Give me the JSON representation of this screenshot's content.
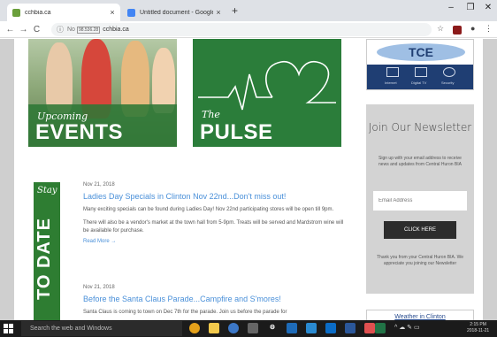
{
  "browser": {
    "tabs": [
      {
        "title": "cchbia.ca",
        "close": "×",
        "favicon_color": "#6a9f3b"
      },
      {
        "title": "Untitled document - Google Docs",
        "close": "×",
        "favicon_color": "#4285f4"
      }
    ],
    "new_tab": "+",
    "window_controls": [
      "–",
      "❐",
      "✕"
    ],
    "nav": {
      "back": "←",
      "forward": "→",
      "reload": "C"
    },
    "address": {
      "info_icon": "ⓘ",
      "security_hint": "No",
      "chip": "98.536.28",
      "url": "cchbia.ca"
    },
    "toolbar_right": {
      "star": "☆",
      "account": "●",
      "menu": "⋮"
    }
  },
  "page": {
    "tiles": [
      {
        "script": "Upcoming",
        "big": "EVENTS"
      },
      {
        "script": "The",
        "big": "PULSE"
      }
    ],
    "tce": {
      "logo_text": "TCE",
      "services": [
        "Internet",
        "Digital TV",
        "Security"
      ]
    },
    "newsletter": {
      "title": "Join Our Newsletter",
      "description": "Sign up with your email address to receive news and updates from Central Huron BIA",
      "email_placeholder": "Email Address",
      "button": "CLICK HERE",
      "thanks": "Thank you from your Central Huron BIA. We appreciate you joining our Newsletter"
    },
    "weather_link": "Weather in Clinton",
    "stay_banner": {
      "script": "Stay",
      "big": "TO DATE"
    },
    "posts": [
      {
        "date": "Nov 21, 2018",
        "title": "Ladies Day Specials in Clinton Nov 22nd...Don't miss out!",
        "paragraphs": [
          "Many exciting specials can be found during Ladies Day! Nov 22nd participating stores will be open till 9pm.",
          "There will also be a vendor's market at the town hall from 5-9pm. Treats will be served and Mardstrom wine will be available for purchase."
        ],
        "read_more": "Read More →"
      },
      {
        "date": "Nov 21, 2018",
        "title": "Before the Santa Claus Parade...Campfire and S'mores!",
        "paragraphs": [
          "Santa Claus is coming to town on Dec 7th for the parade. Join us before the parade for"
        ],
        "read_more": ""
      }
    ]
  },
  "taskbar": {
    "search_placeholder": "Search the web and Windows",
    "tray": "^ ☁ ✎ ▭",
    "clock_time": "2:15 PM",
    "clock_date": "2018-11-21"
  },
  "colors": {
    "green": "#2e7d32",
    "link_blue": "#4a90d9",
    "navy": "#1f3e73"
  }
}
